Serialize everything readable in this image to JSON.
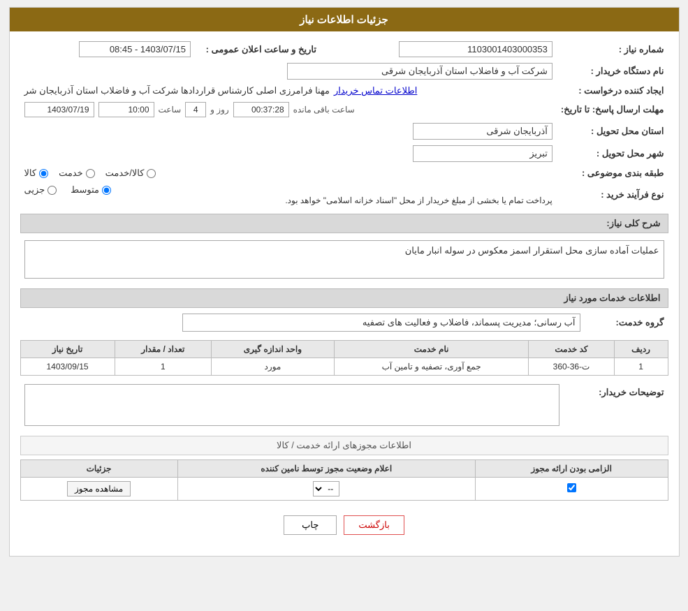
{
  "page": {
    "title": "جزئیات اطلاعات نیاز"
  },
  "fields": {
    "need_number_label": "شماره نیاز :",
    "need_number_value": "1103001403000353",
    "buyer_org_label": "نام دستگاه خریدار :",
    "buyer_org_value": "شرکت آب و فاضلاب استان آذربایجان شرقی",
    "creator_label": "ایجاد کننده درخواست :",
    "creator_value": "مهنا فرامرزی اصلی کارشناس قراردادها شرکت آب و فاضلاب استان آذربایجان شر",
    "creator_link": "اطلاعات تماس خریدار",
    "announce_date_label": "تاریخ و ساعت اعلان عمومی :",
    "announce_date_value": "1403/07/15 - 08:45",
    "response_deadline_label": "مهلت ارسال پاسخ: تا تاریخ:",
    "response_date": "1403/07/19",
    "response_time_label": "ساعت",
    "response_time": "10:00",
    "response_day_label": "روز و",
    "response_days": "4",
    "response_remaining_label": "ساعت باقی مانده",
    "response_remaining": "00:37:28",
    "delivery_province_label": "استان محل تحویل :",
    "delivery_province_value": "آذربایجان شرقی",
    "delivery_city_label": "شهر محل تحویل :",
    "delivery_city_value": "تبریز",
    "category_label": "طبقه بندی موضوعی :",
    "category_options": [
      "کالا",
      "خدمت",
      "کالا/خدمت"
    ],
    "category_selected": "کالا",
    "purchase_type_label": "نوع فرآیند خرید :",
    "purchase_type_options": [
      "جزیی",
      "متوسط"
    ],
    "purchase_type_selected": "متوسط",
    "purchase_note": "پرداخت تمام یا بخشی از مبلغ خریدار از محل \"اسناد خزانه اسلامی\" خواهد بود.",
    "need_desc_label": "شرح کلی نیاز:",
    "need_desc_value": "عملیات آماده سازی محل استقرار اسمز معکوس در سوله انبار مایان",
    "services_info_label": "اطلاعات خدمات مورد نیاز",
    "service_group_label": "گروه خدمت:",
    "service_group_value": "آب رسانی؛ مدیریت پسماند، فاضلاب و فعالیت های تصفیه",
    "table_headers": [
      "ردیف",
      "کد خدمت",
      "نام خدمت",
      "واحد اندازه گیری",
      "تعداد / مقدار",
      "تاریخ نیاز"
    ],
    "table_rows": [
      {
        "row": "1",
        "code": "ت-36-360",
        "name": "جمع آوری، تصفیه و تامین آب",
        "unit": "مورد",
        "qty": "1",
        "date": "1403/09/15"
      }
    ],
    "buyer_note_label": "توضیحات خریدار:",
    "buyer_note_value": "",
    "permits_title": "اطلاعات مجوزهای ارائه خدمت / کالا",
    "permits_headers": [
      "الزامی بودن ارائه مجوز",
      "اعلام وضعیت مجوز توسط نامین کننده",
      "جزئیات"
    ],
    "permits_rows": [
      {
        "required": true,
        "status": "--",
        "details": "مشاهده مجوز"
      }
    ],
    "btn_print": "چاپ",
    "btn_back": "بازگشت"
  }
}
